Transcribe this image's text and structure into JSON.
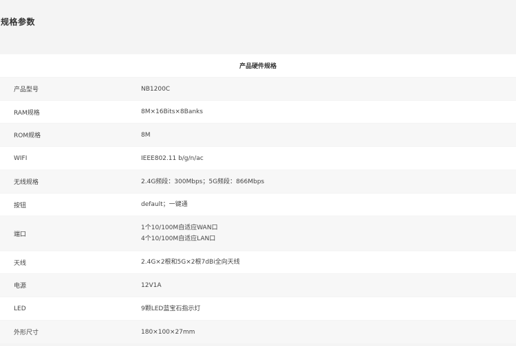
{
  "section": {
    "title": "规格参数"
  },
  "table": {
    "header": "产品硬件规格",
    "rows": [
      {
        "label": "产品型号",
        "value": [
          "NB1200C"
        ]
      },
      {
        "label": "RAM规格",
        "value": [
          "8M×16Bits×8Banks"
        ]
      },
      {
        "label": "ROM规格",
        "value": [
          "8M"
        ]
      },
      {
        "label": "WIFI",
        "value": [
          "IEEE802.11 b/g/n/ac"
        ]
      },
      {
        "label": "无线规格",
        "value": [
          "2.4G频段：300Mbps；5G频段：866Mbps"
        ]
      },
      {
        "label": "按钮",
        "value": [
          "default；一键通"
        ]
      },
      {
        "label": "端口",
        "value": [
          "1个10/100M自适应WAN口",
          "4个10/100M自适应LAN口"
        ]
      },
      {
        "label": "天线",
        "value": [
          "2.4G×2根和5G×2根7dBi全向天线"
        ]
      },
      {
        "label": "电源",
        "value": [
          "12V1A"
        ]
      },
      {
        "label": "LED",
        "value": [
          "9颗LED蓝宝石指示灯"
        ]
      },
      {
        "label": "外形尺寸",
        "value": [
          "180×100×27mm"
        ]
      }
    ]
  }
}
